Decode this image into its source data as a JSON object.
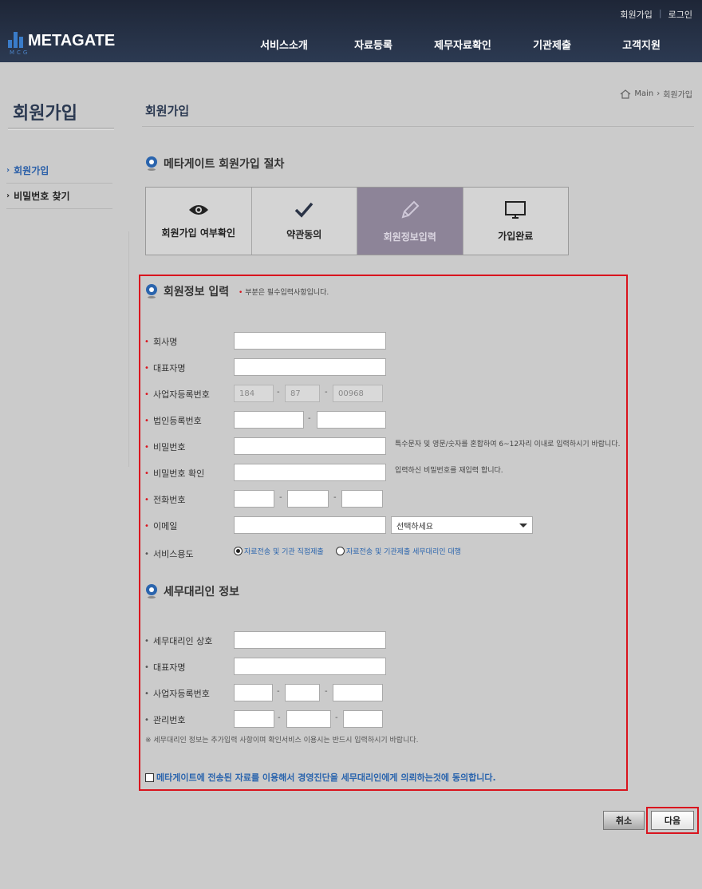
{
  "header": {
    "util_links": [
      "회원가입",
      "로그인"
    ],
    "util_sep": "|",
    "logo_text": "METAGATE",
    "logo_sub": "MCG",
    "logo_color": "#3a7cc9",
    "nav": [
      "서비스소개",
      "자료등록",
      "제무자료확인",
      "기관제출",
      "고객지원"
    ]
  },
  "sidebar": {
    "title": "회원가입",
    "items": [
      {
        "label": "회원가입",
        "active": true
      },
      {
        "label": "비밀번호 찾기",
        "active": false
      }
    ]
  },
  "breadcrumb": {
    "home": "Main",
    "current": "회원가입",
    "sep": "›"
  },
  "page_title": "회원가입",
  "procedure": {
    "title": "메타게이트 회원가입 절차",
    "steps": [
      {
        "label": "회원가입 여부확인",
        "icon": "eye-icon",
        "active": false
      },
      {
        "label": "약관동의",
        "icon": "checkmark-icon",
        "active": false
      },
      {
        "label": "회원정보입력",
        "icon": "pencil-icon",
        "active": true
      },
      {
        "label": "가입완료",
        "icon": "monitor-icon",
        "active": false
      }
    ]
  },
  "member_info": {
    "title": "회원정보 입력",
    "required_note": "부분은 필수입력사항입니다.",
    "fields": {
      "company": {
        "label": "회사명",
        "value": ""
      },
      "ceo": {
        "label": "대표자명",
        "value": ""
      },
      "biz_no": {
        "label": "사업자등록번호",
        "parts": [
          "184",
          "87",
          "00968"
        ]
      },
      "corp_no": {
        "label": "법인등록번호",
        "parts": [
          "",
          ""
        ]
      },
      "password": {
        "label": "비밀번호",
        "value": "",
        "help": "특수문자 및 영문/숫자를 혼합하여 6~12자리 이내로 입력하시기 바랍니다."
      },
      "password_confirm": {
        "label": "비밀번호 확인",
        "value": "",
        "help": "입력하신 비밀번호를 재입력 합니다."
      },
      "phone": {
        "label": "전화번호",
        "parts": [
          "",
          "",
          ""
        ]
      },
      "email": {
        "label": "이메일",
        "value": "",
        "select": "선택하세요"
      },
      "service_use": {
        "label": "서비스용도",
        "options": [
          {
            "label": "자료전송 및 기관 직접제출",
            "checked": true
          },
          {
            "label": "자료전송 및 기관제출 세무대리인 대행",
            "checked": false
          }
        ]
      }
    }
  },
  "agent_info": {
    "title": "세무대리인 정보",
    "fields": {
      "agent_name": {
        "label": "세무대리인 상호",
        "value": ""
      },
      "ceo": {
        "label": "대표자명",
        "value": ""
      },
      "biz_no": {
        "label": "사업자등록번호",
        "parts": [
          "",
          "",
          ""
        ]
      },
      "mgmt_no": {
        "label": "관리번호",
        "parts": [
          "",
          "",
          ""
        ]
      }
    },
    "note": "※ 세무대리인 정보는 추가입력 사항이며 확인서비스 이용시는 반드시 입력하시기 바랍니다.",
    "agree": "메타게이트에 전송된 자료를 이용해서 경영진단을 세무대리인에게 의뢰하는것에 동의합니다.",
    "agree_checked": false
  },
  "buttons": {
    "cancel": "취소",
    "next": "다음"
  },
  "colors": {
    "header_bg": "#1e2637",
    "accent_blue": "#2a64ad",
    "highlight_red": "#d9141e",
    "active_step": "#8d8498"
  }
}
